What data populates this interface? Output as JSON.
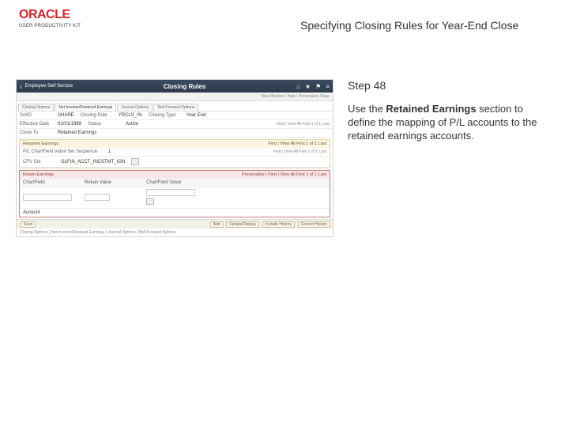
{
  "brand": {
    "name": "ORACLE",
    "subtitle": "USER PRODUCTIVITY KIT"
  },
  "page_title": "Specifying Closing Rules for Year-End Close",
  "step": {
    "label": "Step 48",
    "text_prefix": "Use the ",
    "bold": "Retained Earnings",
    "text_suffix": " section to define the mapping of P/L accounts to the retained earnings accounts."
  },
  "app": {
    "back_label": "Employee Self Service",
    "title": "Closing Rules",
    "icons": {
      "home": "⌂",
      "star": "★",
      "flag": "⚑",
      "menu": "≡"
    },
    "subbar": "New Window | Help | Personalize Page"
  },
  "tabs": [
    {
      "label": "Closing Options"
    },
    {
      "label": "Net Income/Retained Earnings",
      "active": true
    },
    {
      "label": "Journal Options"
    },
    {
      "label": "Roll Forward Options"
    }
  ],
  "topfields": [
    {
      "label": "SetID",
      "value": "SHARE"
    },
    {
      "label": "Closing Rule",
      "value": "YRCLS_I%"
    },
    {
      "label": "Closing Type",
      "value": "Year End"
    }
  ],
  "eff_row": {
    "label": "Effective Date",
    "value": "01/01/1989",
    "status": "Status",
    "status_val": "Active",
    "nav": "Find | View All   First  1 of 1  Last"
  },
  "close_to_row": {
    "label": "Close To",
    "value": "Retained Earnings"
  },
  "retained": {
    "title": "Retained Earnings",
    "nav": "Find | View All   First  1 of 1  Last",
    "seq_label": "P/L ChartField Value Set Sequence",
    "seq_value": "1",
    "nav2": "Find | View All   First  1 of 1  Last",
    "cfvs_label": "CFV Set",
    "cfvs_value": "GLFIN_ACCT_INCSTMT_IGN"
  },
  "reearn": {
    "title": "Retain Earnings",
    "nav": "Personalize | Find | View All   First  1 of 1  Last",
    "hdr": [
      "ChartField",
      "Retain Value",
      "ChartField Value"
    ],
    "row": [
      "Account",
      "",
      ""
    ]
  },
  "save_label": "Save",
  "bottom_buttons": [
    "Add",
    "Update/Display",
    "Include History",
    "Correct History"
  ],
  "crumbs": "Closing Options | Net Income/Retained Earnings | Journal Options | Roll Forward Options"
}
